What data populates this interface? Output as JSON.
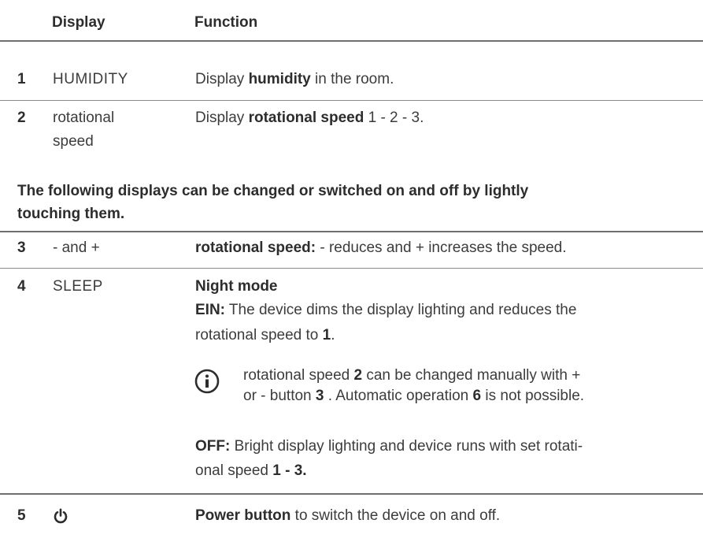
{
  "header": {
    "display_label": "Display",
    "function_label": "Function"
  },
  "rows_top": [
    {
      "num": "1",
      "display": "HUMIDITY",
      "fn_pre": "Display ",
      "fn_bold": "humidity",
      "fn_post": " in the room."
    },
    {
      "num": "2",
      "display_line1": "rotational",
      "display_line2": "speed",
      "fn_pre": "Display ",
      "fn_bold": "rotational speed",
      "fn_post": " 1 - 2 - 3."
    }
  ],
  "section_note": {
    "line1": "The following displays can be changed or switched on and off by lightly",
    "line2": "touching them."
  },
  "row3": {
    "num": "3",
    "display": "- and +",
    "fn_bold": "rotational speed:",
    "fn_post": " - reduces and + increases the speed."
  },
  "row4": {
    "num": "4",
    "display": "SLEEP",
    "title": "Night mode",
    "ein_label": "EIN:",
    "ein_text_1": " The device dims the display lighting and reduces the",
    "ein_text_2_pre": "rotational speed to ",
    "ein_text_2_bold": "1",
    "ein_text_2_post": ".",
    "info_line1_pre": "rotational speed ",
    "info_line1_bold": "2",
    "info_line1_post": " can be changed manually with +",
    "info_line2_pre": "or - button ",
    "info_line2_bold1": "3",
    "info_line2_mid": " . Automatic operation ",
    "info_line2_bold2": "6",
    "info_line2_post": " is not possible.",
    "off_label": "OFF:",
    "off_text_1": " Bright display lighting and device runs with set rotati-",
    "off_text_2_pre": "onal speed ",
    "off_text_2_bold": "1 - 3."
  },
  "row5": {
    "num": "5",
    "icon": "power-icon",
    "fn_bold": "Power button",
    "fn_post": " to switch the device on and off."
  },
  "colors": {
    "text": "#3c3c3c",
    "text_bold": "#2d2d2d",
    "rule": "#8a8a8a"
  }
}
